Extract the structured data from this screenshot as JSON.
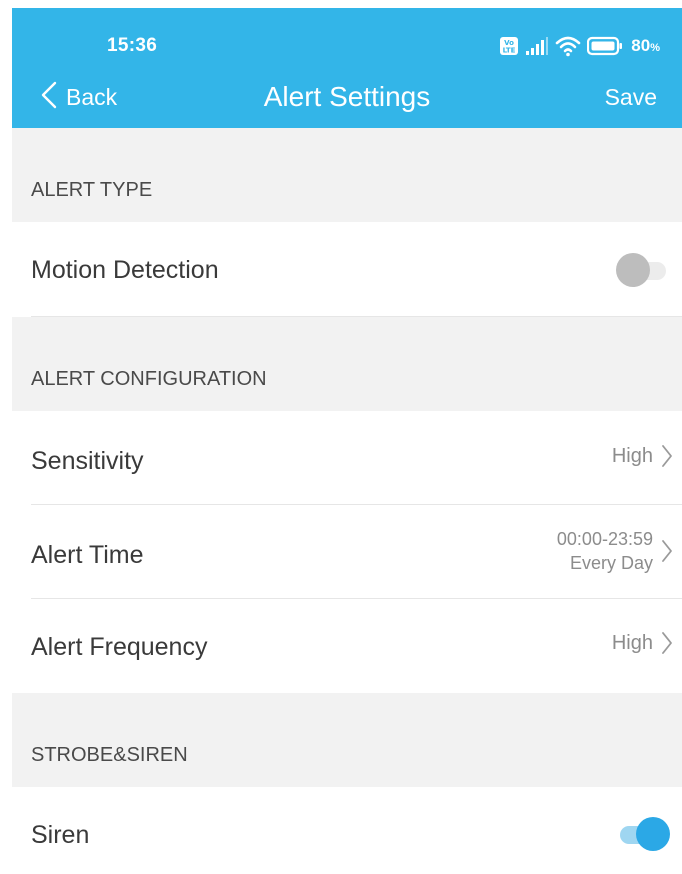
{
  "status_bar": {
    "time": "15:36",
    "network": "VoLTE",
    "battery_percent": "80",
    "battery_unit": "%"
  },
  "header": {
    "back_label": "Back",
    "title": "Alert Settings",
    "save_label": "Save",
    "background_color": "#33b5e8"
  },
  "sections": {
    "alert_type": {
      "title": "ALERT TYPE",
      "motion_detection": {
        "label": "Motion Detection",
        "enabled": false
      }
    },
    "alert_configuration": {
      "title": "ALERT CONFIGURATION",
      "sensitivity": {
        "label": "Sensitivity",
        "value": "High"
      },
      "alert_time": {
        "label": "Alert Time",
        "value_line1": "00:00-23:59",
        "value_line2": "Every Day"
      },
      "alert_frequency": {
        "label": "Alert Frequency",
        "value": "High"
      }
    },
    "strobe_siren": {
      "title": "STROBE&SIREN",
      "siren": {
        "label": "Siren",
        "enabled": true
      }
    }
  },
  "icons": {
    "back": "chevron-left-icon",
    "row_arrow": "chevron-right-icon",
    "signal": "signal-icon",
    "wifi": "wifi-icon",
    "battery": "battery-icon"
  },
  "colors": {
    "accent": "#33b5e8",
    "toggle_on": "#2ba8e6",
    "toggle_off": "#bdbdbd"
  }
}
